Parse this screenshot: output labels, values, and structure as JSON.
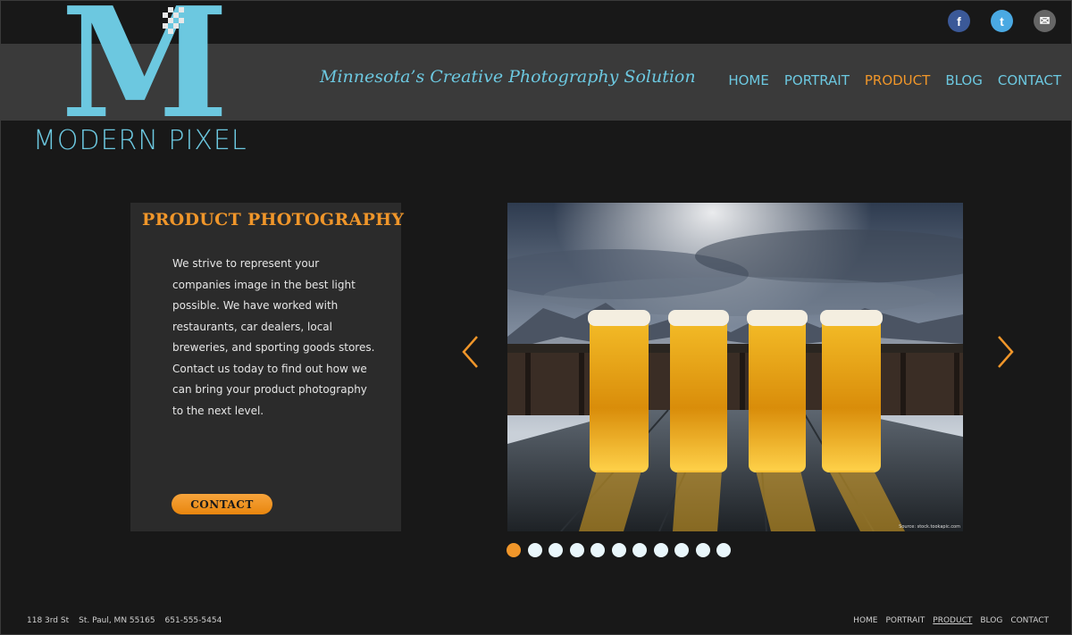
{
  "brand": {
    "logo_letter": "M",
    "name": "MODERN PIXEL",
    "tagline": "Minnesota’s Creative Photography Solution"
  },
  "social": [
    {
      "name": "facebook-icon",
      "glyph": "f"
    },
    {
      "name": "twitter-icon",
      "glyph": "t"
    },
    {
      "name": "email-icon",
      "glyph": "✉"
    }
  ],
  "nav": {
    "items": [
      {
        "label": "HOME",
        "active": false
      },
      {
        "label": "PORTRAIT",
        "active": false
      },
      {
        "label": "PRODUCT",
        "active": true
      },
      {
        "label": "BLOG",
        "active": false
      },
      {
        "label": "CONTACT",
        "active": false
      }
    ]
  },
  "content": {
    "title": "PRODUCT PHOTOGRAPHY",
    "body": "We strive to represent your companies image in the best light possible. We have worked with restaurants, car dealers, local breweries, and sporting goods stores. Contact us today to find out how we can bring your product photography to the next level.",
    "button_label": "CONTACT"
  },
  "slideshow": {
    "image_description_icon": "beer-glasses-photo",
    "credit": "Source: stock.tookapic.com",
    "total_slides": 11,
    "active_slide": 1
  },
  "footer": {
    "street": "118 3rd St",
    "city": "St. Paul, MN 55165",
    "phone": "651-555-5454",
    "nav": [
      {
        "label": "HOME",
        "active": false
      },
      {
        "label": "PORTRAIT",
        "active": false
      },
      {
        "label": "PRODUCT",
        "active": true
      },
      {
        "label": "BLOG",
        "active": false
      },
      {
        "label": "CONTACT",
        "active": false
      }
    ]
  },
  "colors": {
    "accent_blue": "#6cc8e0",
    "accent_orange": "#f0962a",
    "background": "#181818",
    "band": "#3a3a3a",
    "card": "#2b2b2b"
  }
}
